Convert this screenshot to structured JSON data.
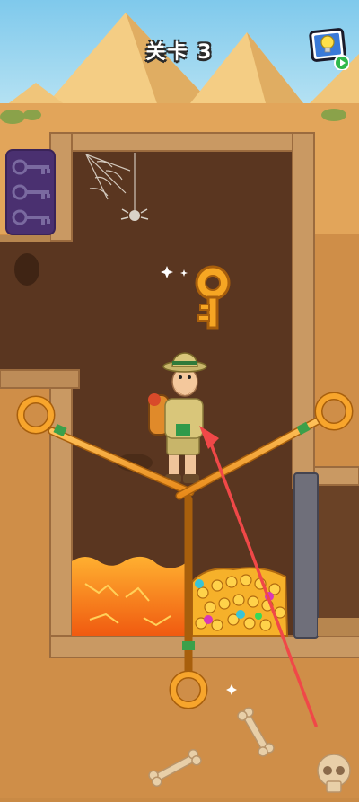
{
  "hud": {
    "level_label": "关卡 3",
    "hint_icon": "lightbulb-icon",
    "play_badge_icon": "play-icon"
  },
  "inventory": {
    "keys_total": 3,
    "keys_collected": 0,
    "icon": "key-icon"
  },
  "puzzle": {
    "pins": [
      {
        "id": "pin-left",
        "direction": "diagonal",
        "handle": "left"
      },
      {
        "id": "pin-right",
        "direction": "diagonal",
        "handle": "right"
      },
      {
        "id": "pin-bottom",
        "direction": "vertical",
        "handle": "bottom"
      }
    ],
    "hazards": [
      "lava"
    ],
    "rewards": [
      "golden-key",
      "treasure-coins-gems"
    ]
  },
  "colors": {
    "sky": "#8fd3f0",
    "sand": "#e2a55a",
    "pyramid": "#f2c77a",
    "cave_wall": "#5a3620",
    "stone_frame": "#c99963",
    "lava": "#ff7a12",
    "pin": "#f7a52c",
    "key": "#f6a623",
    "keys_panel": "#4a3070",
    "hint_arrow": "#f04848"
  }
}
